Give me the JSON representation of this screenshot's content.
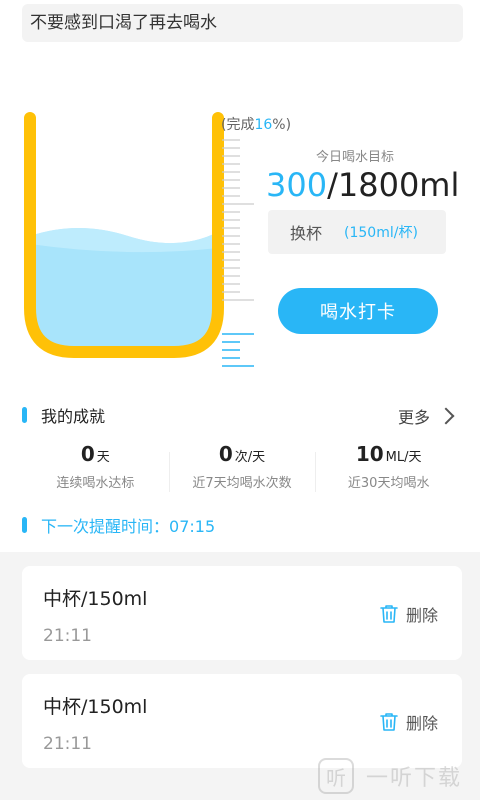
{
  "tip": "不要感到口渴了再去喝水",
  "progress": {
    "prefix": "(完成",
    "percent": "16",
    "suffix": "%)",
    "fill_fraction": 0.16
  },
  "goal": {
    "label": "今日喝水目标",
    "current": "300",
    "target": "/1800ml"
  },
  "change_cup": {
    "label": "换杯",
    "size": "(150ml/杯)"
  },
  "checkin_button": "喝水打卡",
  "achievements": {
    "title": "我的成就",
    "more": "更多",
    "stats": [
      {
        "value": "0",
        "unit": "天",
        "desc": "连续喝水达标"
      },
      {
        "value": "0",
        "unit": "次/天",
        "desc": "近7天均喝水次数"
      },
      {
        "value": "10",
        "unit": "ML/天",
        "desc": "近30天均喝水"
      }
    ]
  },
  "reminder": {
    "label": "下一次提醒时间：",
    "time": "07:15"
  },
  "records": [
    {
      "name": "中杯/150ml",
      "time": "21:11",
      "delete": "删除"
    },
    {
      "name": "中杯/150ml",
      "time": "21:11",
      "delete": "删除"
    }
  ],
  "watermark": {
    "logo": "听",
    "text": "一听下载"
  },
  "colors": {
    "accent": "#29b6f6",
    "cup": "#ffc107",
    "water": "#a8e4fb"
  }
}
